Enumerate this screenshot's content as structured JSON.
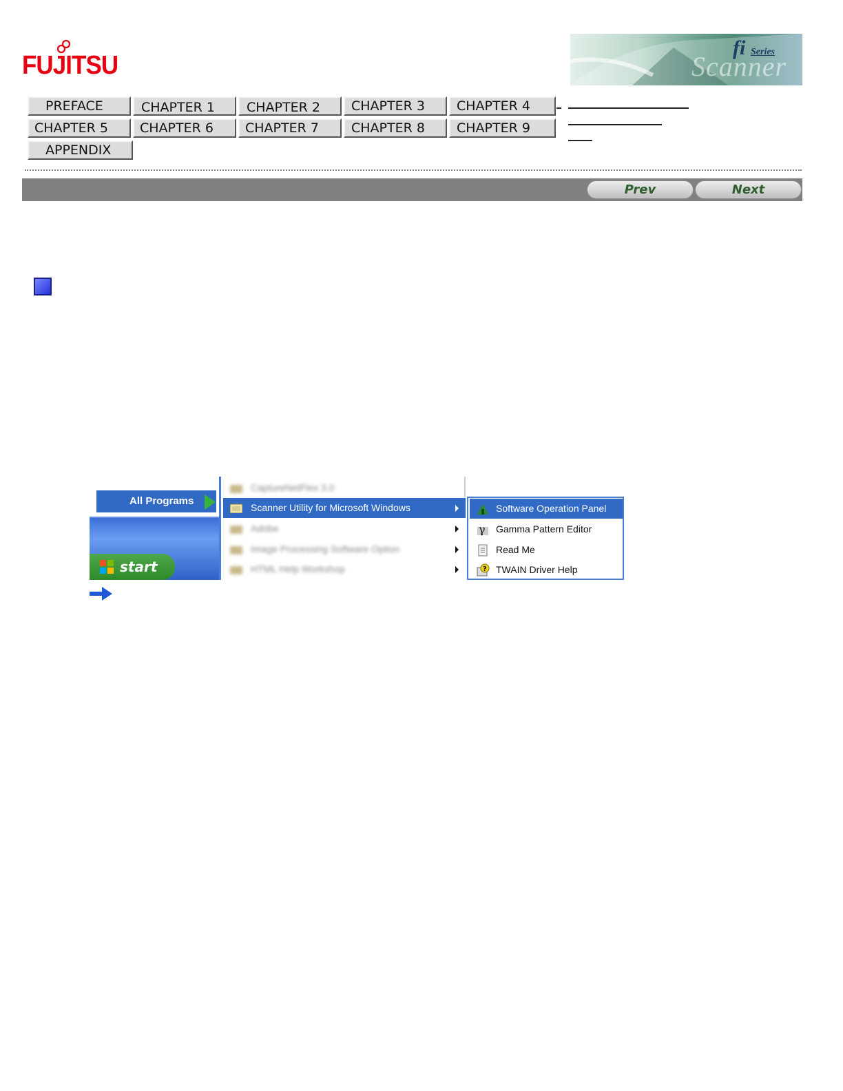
{
  "header": {
    "brand": "FUJITSU",
    "banner": {
      "fi": "fi",
      "series": "Series",
      "scanner": "Scanner"
    }
  },
  "nav": {
    "buttons": [
      "PREFACE",
      "CHAPTER 1",
      "CHAPTER 2",
      "CHAPTER 3",
      "CHAPTER 4",
      "CHAPTER 5",
      "CHAPTER 6",
      "CHAPTER 7",
      "CHAPTER 8",
      "CHAPTER 9",
      "APPENDIX"
    ]
  },
  "toolbar": {
    "prev_label": "Prev",
    "next_label": "Next"
  },
  "screenshot": {
    "all_programs": "All Programs",
    "start_label": "start",
    "program_menu": {
      "selected_item": "Scanner Utility for Microsoft Windows",
      "blurred_items": [
        "CaptureNetFlex 3.0",
        "Adobe",
        "Image Processing Software Option",
        "HTML Help Workshop"
      ]
    },
    "submenu": {
      "items": [
        "Software Operation Panel",
        "Gamma Pattern Editor",
        "Read Me",
        "TWAIN Driver Help"
      ]
    }
  },
  "colors": {
    "brand_red": "#e60012",
    "menu_highlight": "#316ac5",
    "gray_bar": "#808080"
  }
}
